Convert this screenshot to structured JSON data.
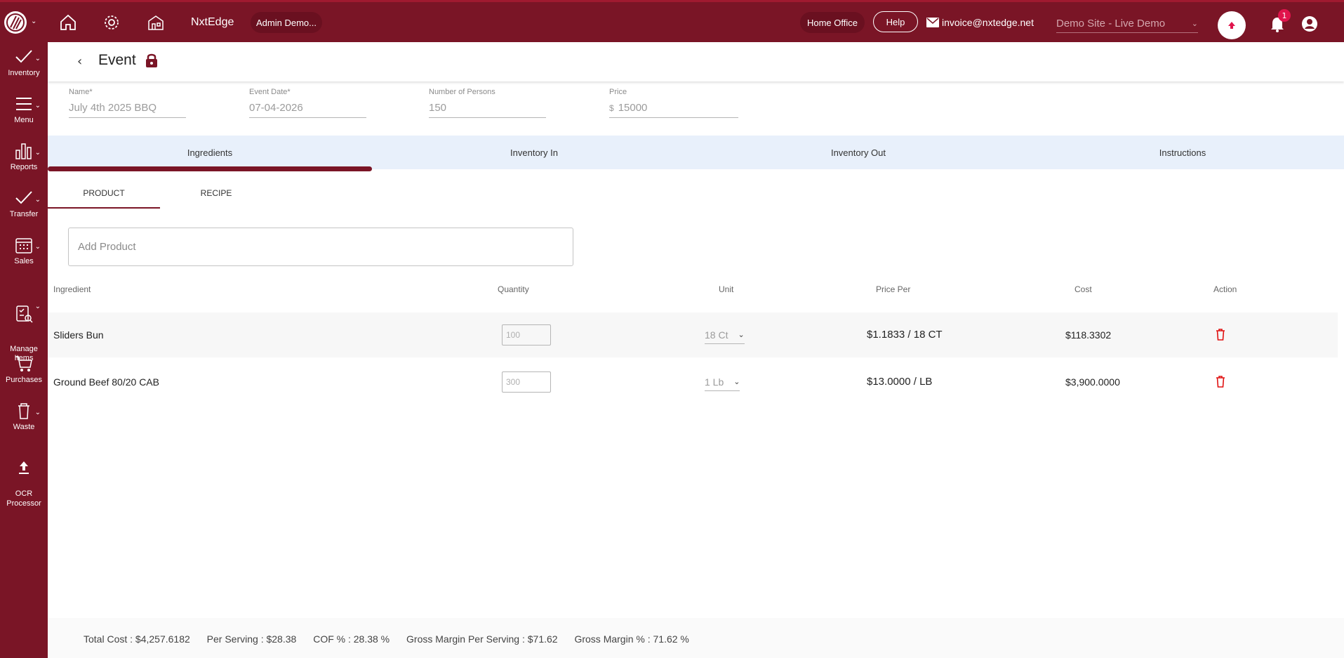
{
  "topbar": {
    "brand": "NxtEdge",
    "user_pill": "Admin Demo...",
    "home_office": "Home Office",
    "help": "Help",
    "email": "invoice@nxtedge.net",
    "site": "Demo Site - Live Demo",
    "notification_count": "1"
  },
  "sidebar": {
    "items": [
      {
        "label": "Inventory"
      },
      {
        "label": "Menu"
      },
      {
        "label": "Reports"
      },
      {
        "label": "Transfer"
      },
      {
        "label": "Sales"
      },
      {
        "label": "Manage\nItems"
      },
      {
        "label": "Purchases"
      },
      {
        "label": "Waste"
      },
      {
        "label": "OCR\nProcessor"
      }
    ]
  },
  "page": {
    "title": "Event"
  },
  "form": {
    "name_label": "Name*",
    "name_value": "July 4th 2025 BBQ",
    "date_label": "Event Date*",
    "date_value": "07-04-2026",
    "persons_label": "Number of Persons",
    "persons_value": "150",
    "price_label": "Price",
    "price_currency": "$",
    "price_value": "15000"
  },
  "tabs": [
    "Ingredients",
    "Inventory In",
    "Inventory Out",
    "Instructions"
  ],
  "subtabs": [
    "PRODUCT",
    "RECIPE"
  ],
  "add_product_placeholder": "Add Product",
  "table": {
    "headers": [
      "Ingredient",
      "Quantity",
      "Unit",
      "Price Per",
      "Cost",
      "Action"
    ],
    "rows": [
      {
        "ingredient": "Sliders Bun",
        "quantity": "100",
        "unit": "18 Ct",
        "price_per": "$1.1833 / 18 CT",
        "cost": "$118.3302"
      },
      {
        "ingredient": "Ground Beef 80/20 CAB",
        "quantity": "300",
        "unit": "1 Lb",
        "price_per": "$13.0000 / LB",
        "cost": "$3,900.0000"
      }
    ]
  },
  "totals": {
    "total_cost": "Total Cost : $4,257.6182",
    "per_serving": "Per Serving : $28.38",
    "cof": "COF % : 28.38 %",
    "gm_per_serving": "Gross Margin Per Serving : $71.62",
    "gm_pct": "Gross Margin % : 71.62 %"
  },
  "colors": {
    "brand": "#7a1526",
    "tab_bg": "#e8f0fb",
    "danger": "#e0144c"
  }
}
